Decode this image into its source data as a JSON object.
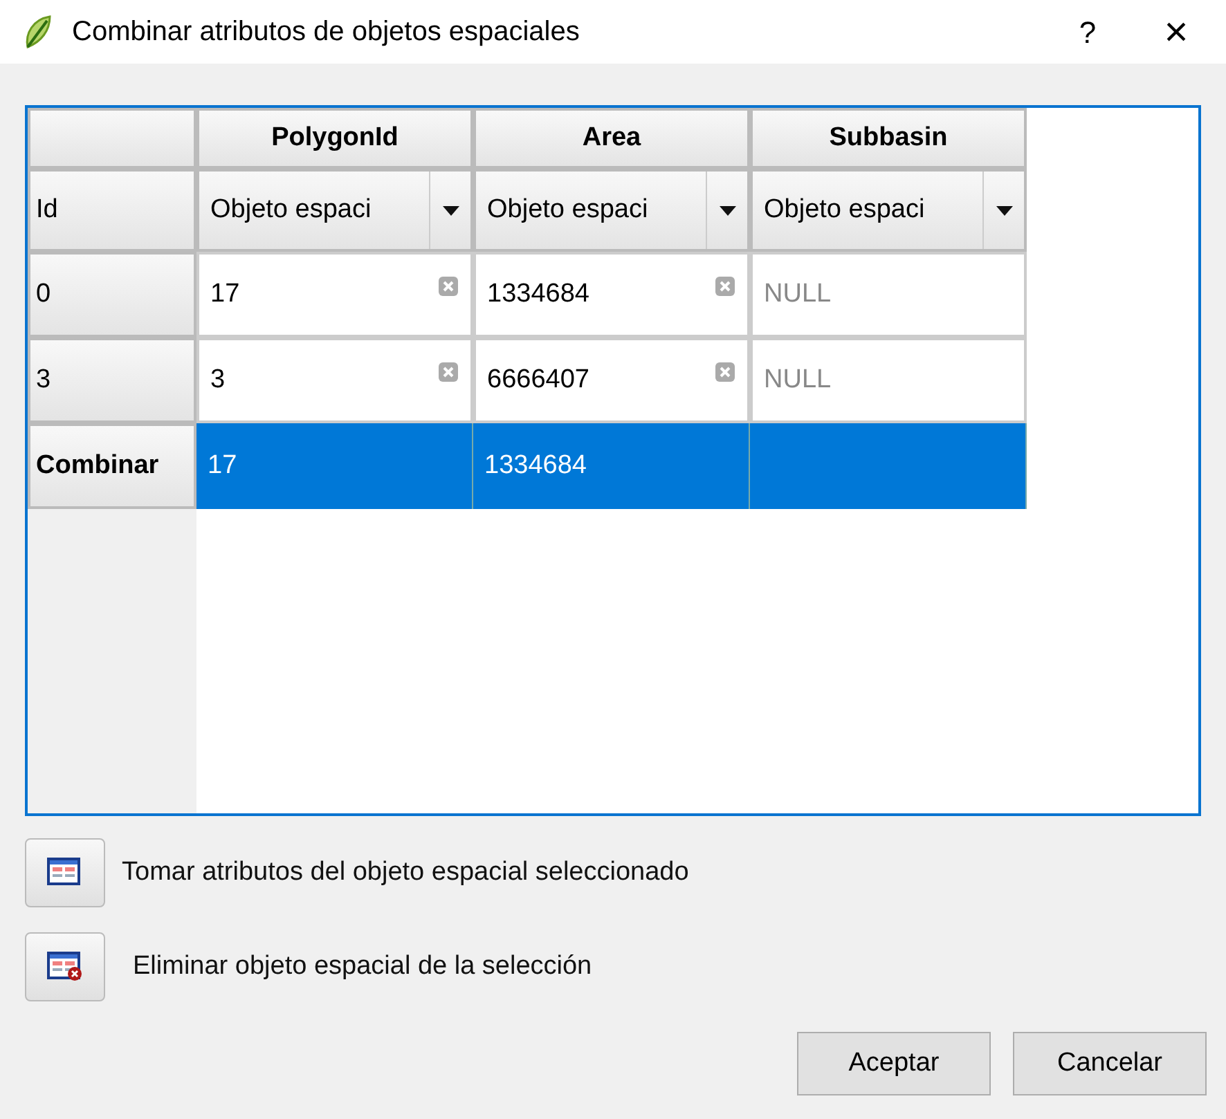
{
  "window": {
    "title": "Combinar atributos de objetos espaciales",
    "help": "?",
    "close": "×"
  },
  "table": {
    "columns": [
      "PolygonId",
      "Area",
      "Subbasin"
    ],
    "combo_row": {
      "header": "Id",
      "combos": [
        "Objeto espaci",
        "Objeto espaci",
        "Objeto espaci"
      ]
    },
    "rows": [
      {
        "header": "0",
        "selected": false,
        "cells": [
          {
            "kind": "value",
            "text": "17"
          },
          {
            "kind": "value",
            "text": "1334684"
          },
          {
            "kind": "null",
            "placeholder": "NULL"
          }
        ]
      },
      {
        "header": "3",
        "selected": false,
        "cells": [
          {
            "kind": "value",
            "text": "3"
          },
          {
            "kind": "value",
            "text": "6666407"
          },
          {
            "kind": "null",
            "placeholder": "NULL"
          }
        ]
      },
      {
        "header": "Combinar",
        "selected": true,
        "cells": [
          {
            "text": "17"
          },
          {
            "text": "1334684"
          },
          {}
        ]
      }
    ]
  },
  "actions": [
    {
      "kind": "take",
      "label": "Tomar atributos del objeto espacial seleccionado"
    },
    {
      "kind": "remove",
      "label": "Eliminar objeto espacial de la selección"
    }
  ],
  "buttons": [
    "Aceptar",
    "Cancelar"
  ]
}
